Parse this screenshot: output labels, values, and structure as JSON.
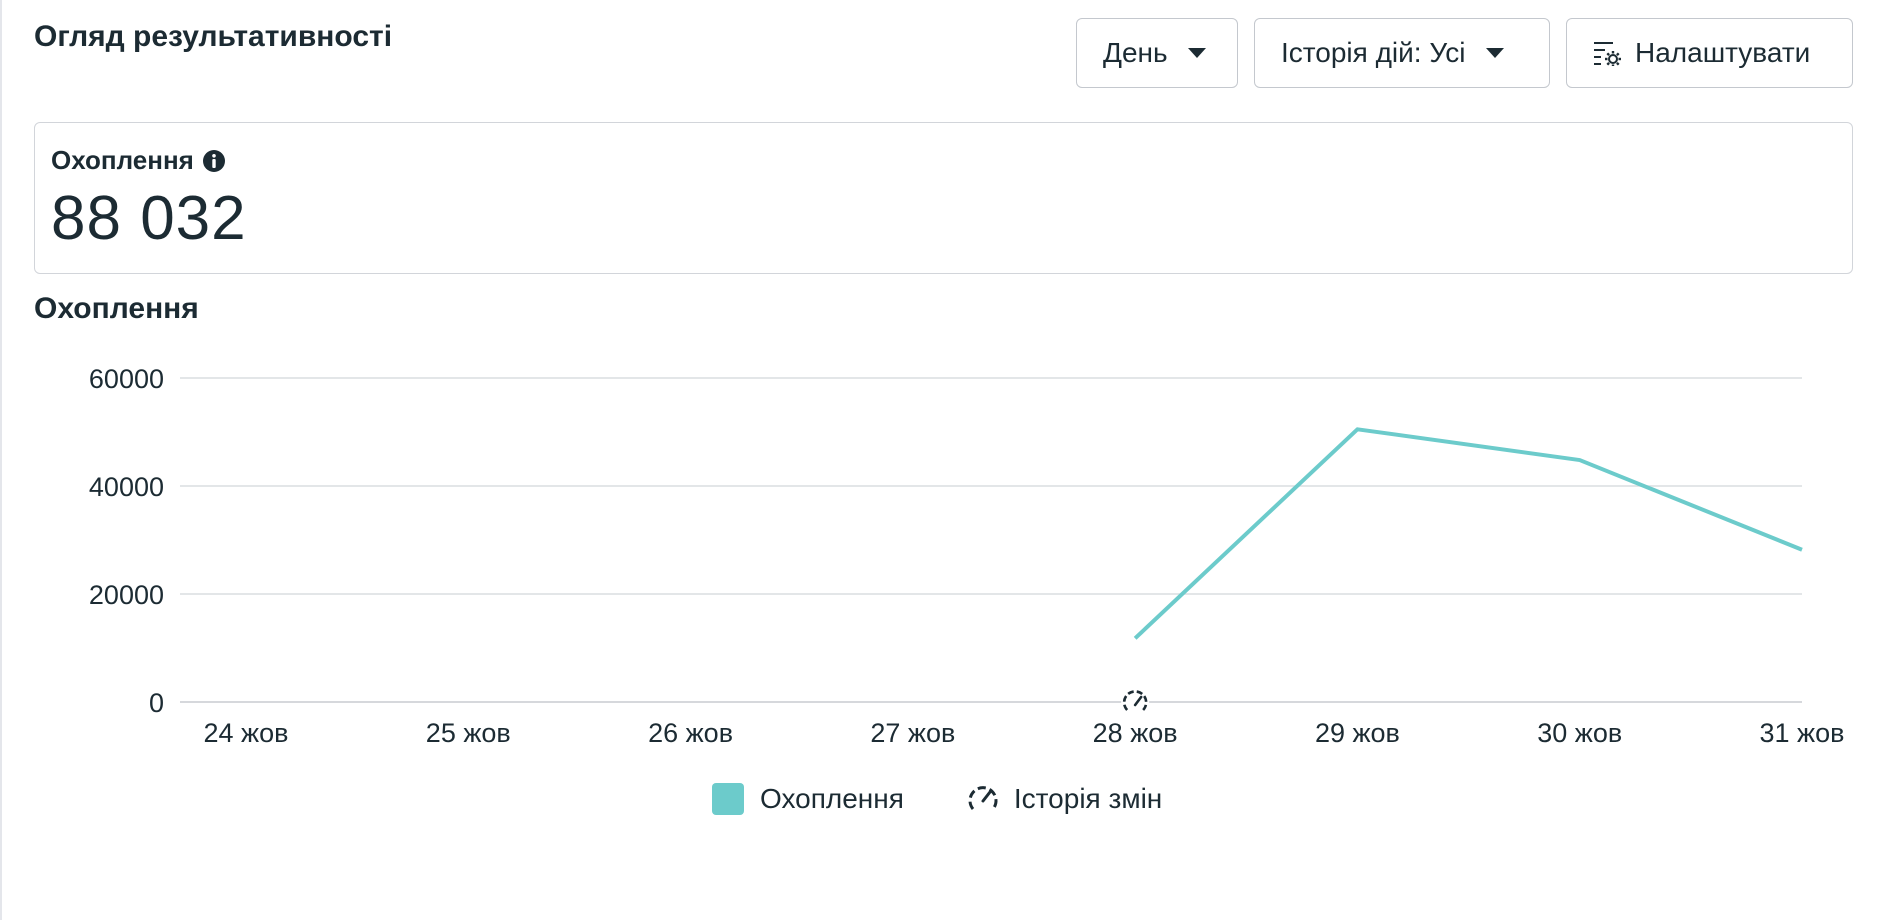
{
  "header": {
    "title": "Огляд результативності",
    "period_dropdown": "День",
    "history_dropdown": "Історія дій: Усі",
    "settings_button": "Налаштувати"
  },
  "metric": {
    "label": "Охоплення",
    "value": "88 032"
  },
  "chart_title": "Охоплення",
  "legend": {
    "series_label": "Охоплення",
    "history_label": "Історія змін"
  },
  "colors": {
    "series": "#6ccbcb",
    "text": "#1c2b33",
    "grid": "#dadde1"
  },
  "chart_data": {
    "type": "line",
    "title": "Охоплення",
    "x": [
      "24 жов",
      "25 жов",
      "26 жов",
      "27 жов",
      "28 жов",
      "29 жов",
      "30 жов",
      "31 жов"
    ],
    "yticks": [
      0,
      20000,
      40000,
      60000
    ],
    "ylim": [
      0,
      60000
    ],
    "series": [
      {
        "name": "Охоплення",
        "values": [
          null,
          null,
          null,
          null,
          11800,
          50500,
          44800,
          28200
        ]
      }
    ],
    "history_markers": [
      "28 жов"
    ],
    "grid": true,
    "legend": "bottom-center"
  }
}
